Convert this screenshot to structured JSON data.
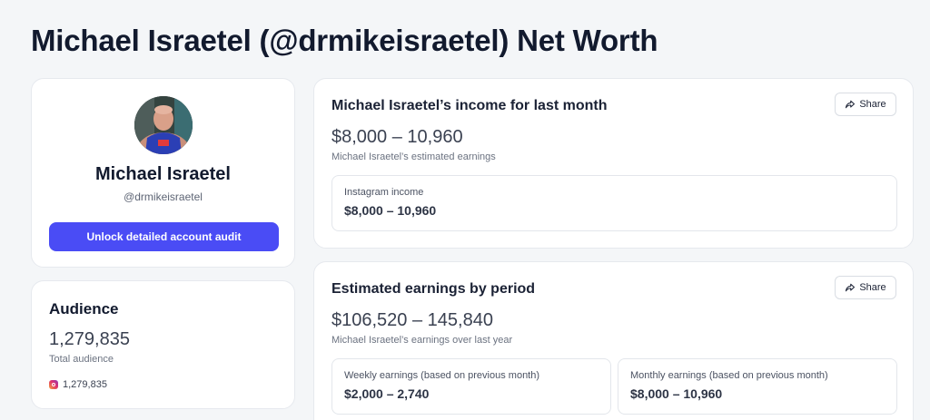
{
  "page": {
    "title": "Michael Israetel (@drmikeisraetel) Net Worth"
  },
  "profile": {
    "name": "Michael Israetel",
    "handle": "@drmikeisraetel",
    "audit_button_label": "Unlock detailed account audit"
  },
  "audience": {
    "title": "Audience",
    "total": "1,279,835",
    "total_label": "Total audience",
    "instagram_count": "1,279,835",
    "instagram_icon": "instagram-icon"
  },
  "income_card": {
    "title": "Michael Israetel’s income for last month",
    "share_label": "Share",
    "range": "$8,000 – 10,960",
    "caption": "Michael Israetel’s estimated earnings",
    "instagram": {
      "label": "Instagram income",
      "value": "$8,000 – 10,960"
    }
  },
  "earnings_card": {
    "title": "Estimated earnings by period",
    "share_label": "Share",
    "range": "$106,520 – 145,840",
    "caption": "Michael Israetel’s earnings over last year",
    "weekly": {
      "label": "Weekly earnings (based on previous month)",
      "value": "$2,000 – 2,740"
    },
    "monthly": {
      "label": "Monthly earnings (based on previous month)",
      "value": "$8,000 – 10,960"
    }
  },
  "colors": {
    "accent": "#4a4cf5",
    "background": "#f4f6f8",
    "card": "#ffffff"
  }
}
